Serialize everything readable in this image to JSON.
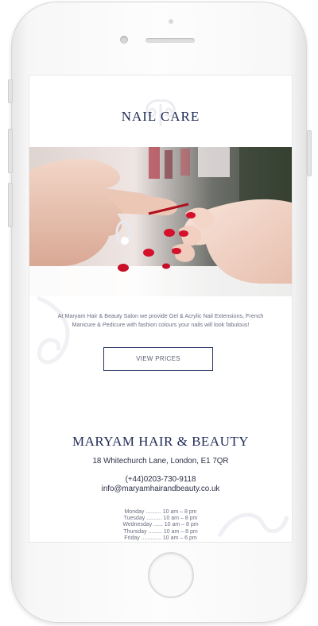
{
  "page": {
    "section_title": "NAIL CARE",
    "description": "At Maryam Hair & Beauty Salon we provide Gel & Acrylic Nail Extensions, French Manicure & Pedicure with fashion colours your nails will look fabulous!",
    "view_prices_label": "VIEW PRICES"
  },
  "footer": {
    "brand": "MARYAM HAIR & BEAUTY",
    "address": "18 Whitechurch Lane, London, E1 7QR",
    "phone": "(+44)0203-730-9118",
    "email": "info@maryamhairandbeauty.co.uk",
    "hours": [
      "Monday .......... 10 am – 8 pm",
      "Tuesday .......... 10 am – 8 pm",
      "Wednesday ...... 10 am – 8 pm",
      "Thursday ......... 10 am – 8 pm",
      "Friday ............. 10 am – 6 pm"
    ]
  },
  "colors": {
    "brand_navy": "#1f2a55",
    "body_text": "#6a6f80",
    "nail_polish": "#d4102b"
  },
  "icons": [
    "ornament-flourish",
    "hero-photo-nail-painting"
  ]
}
